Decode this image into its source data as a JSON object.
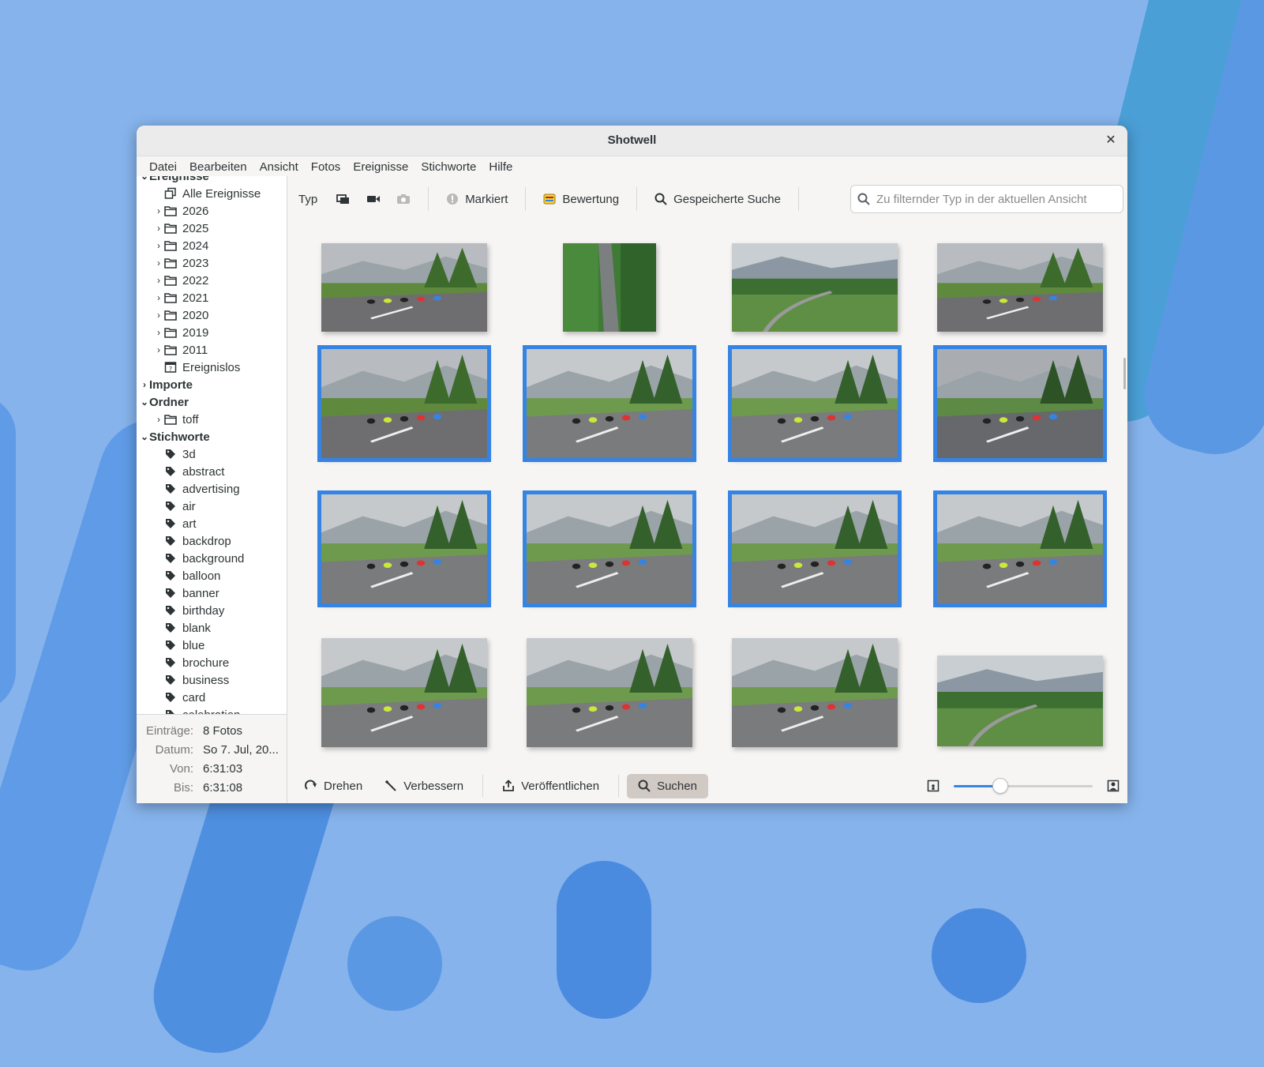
{
  "window": {
    "title": "Shotwell"
  },
  "menu": [
    "Datei",
    "Bearbeiten",
    "Ansicht",
    "Fotos",
    "Ereignisse",
    "Stichworte",
    "Hilfe"
  ],
  "sidebar": {
    "events_header": "Ereignisse",
    "all_events": "Alle Ereignisse",
    "years": [
      "2026",
      "2025",
      "2024",
      "2023",
      "2022",
      "2021",
      "2020",
      "2019",
      "2011"
    ],
    "no_event": "Ereignislos",
    "imports": "Importe",
    "folders_header": "Ordner",
    "folders": [
      "toff"
    ],
    "tags_header": "Stichworte",
    "tags": [
      "3d",
      "abstract",
      "advertising",
      "air",
      "art",
      "backdrop",
      "background",
      "balloon",
      "banner",
      "birthday",
      "blank",
      "blue",
      "brochure",
      "business",
      "card",
      "celebration"
    ]
  },
  "info": {
    "entries_label": "Einträge:",
    "entries_value": "8 Fotos",
    "date_label": "Datum:",
    "date_value": "So 7. Jul, 20...",
    "from_label": "Von:",
    "from_value": "6:31:03",
    "to_label": "Bis:",
    "to_value": "6:31:08"
  },
  "toolbar": {
    "type_label": "Typ",
    "flagged_label": "Markiert",
    "rating_label": "Bewertung",
    "saved_search_label": "Gespeicherte Suche",
    "filter_placeholder": "Zu filternder Typ in der aktuellen Ansicht"
  },
  "bottombar": {
    "rotate_label": "Drehen",
    "enhance_label": "Verbessern",
    "publish_label": "Veröffentlichen",
    "search_label": "Suchen",
    "zoom_level": 0.33
  },
  "photos": [
    {
      "row": 0,
      "col": 0,
      "selected": false,
      "scene": "rider"
    },
    {
      "row": 0,
      "col": 1,
      "selected": false,
      "scene": "road-aerial"
    },
    {
      "row": 0,
      "col": 2,
      "selected": false,
      "scene": "valley"
    },
    {
      "row": 0,
      "col": 3,
      "selected": false,
      "scene": "rider"
    },
    {
      "row": 1,
      "col": 0,
      "selected": true,
      "scene": "rider"
    },
    {
      "row": 1,
      "col": 1,
      "selected": true,
      "scene": "peloton"
    },
    {
      "row": 1,
      "col": 2,
      "selected": true,
      "scene": "peloton"
    },
    {
      "row": 1,
      "col": 3,
      "selected": true,
      "scene": "peloton-dark"
    },
    {
      "row": 2,
      "col": 0,
      "selected": true,
      "scene": "peloton"
    },
    {
      "row": 2,
      "col": 1,
      "selected": true,
      "scene": "peloton"
    },
    {
      "row": 2,
      "col": 2,
      "selected": true,
      "scene": "peloton"
    },
    {
      "row": 2,
      "col": 3,
      "selected": true,
      "scene": "peloton"
    },
    {
      "row": 3,
      "col": 0,
      "selected": false,
      "scene": "peloton"
    },
    {
      "row": 3,
      "col": 1,
      "selected": false,
      "scene": "peloton"
    },
    {
      "row": 3,
      "col": 2,
      "selected": false,
      "scene": "peloton"
    },
    {
      "row": 3,
      "col": 3,
      "selected": false,
      "scene": "valley"
    }
  ]
}
